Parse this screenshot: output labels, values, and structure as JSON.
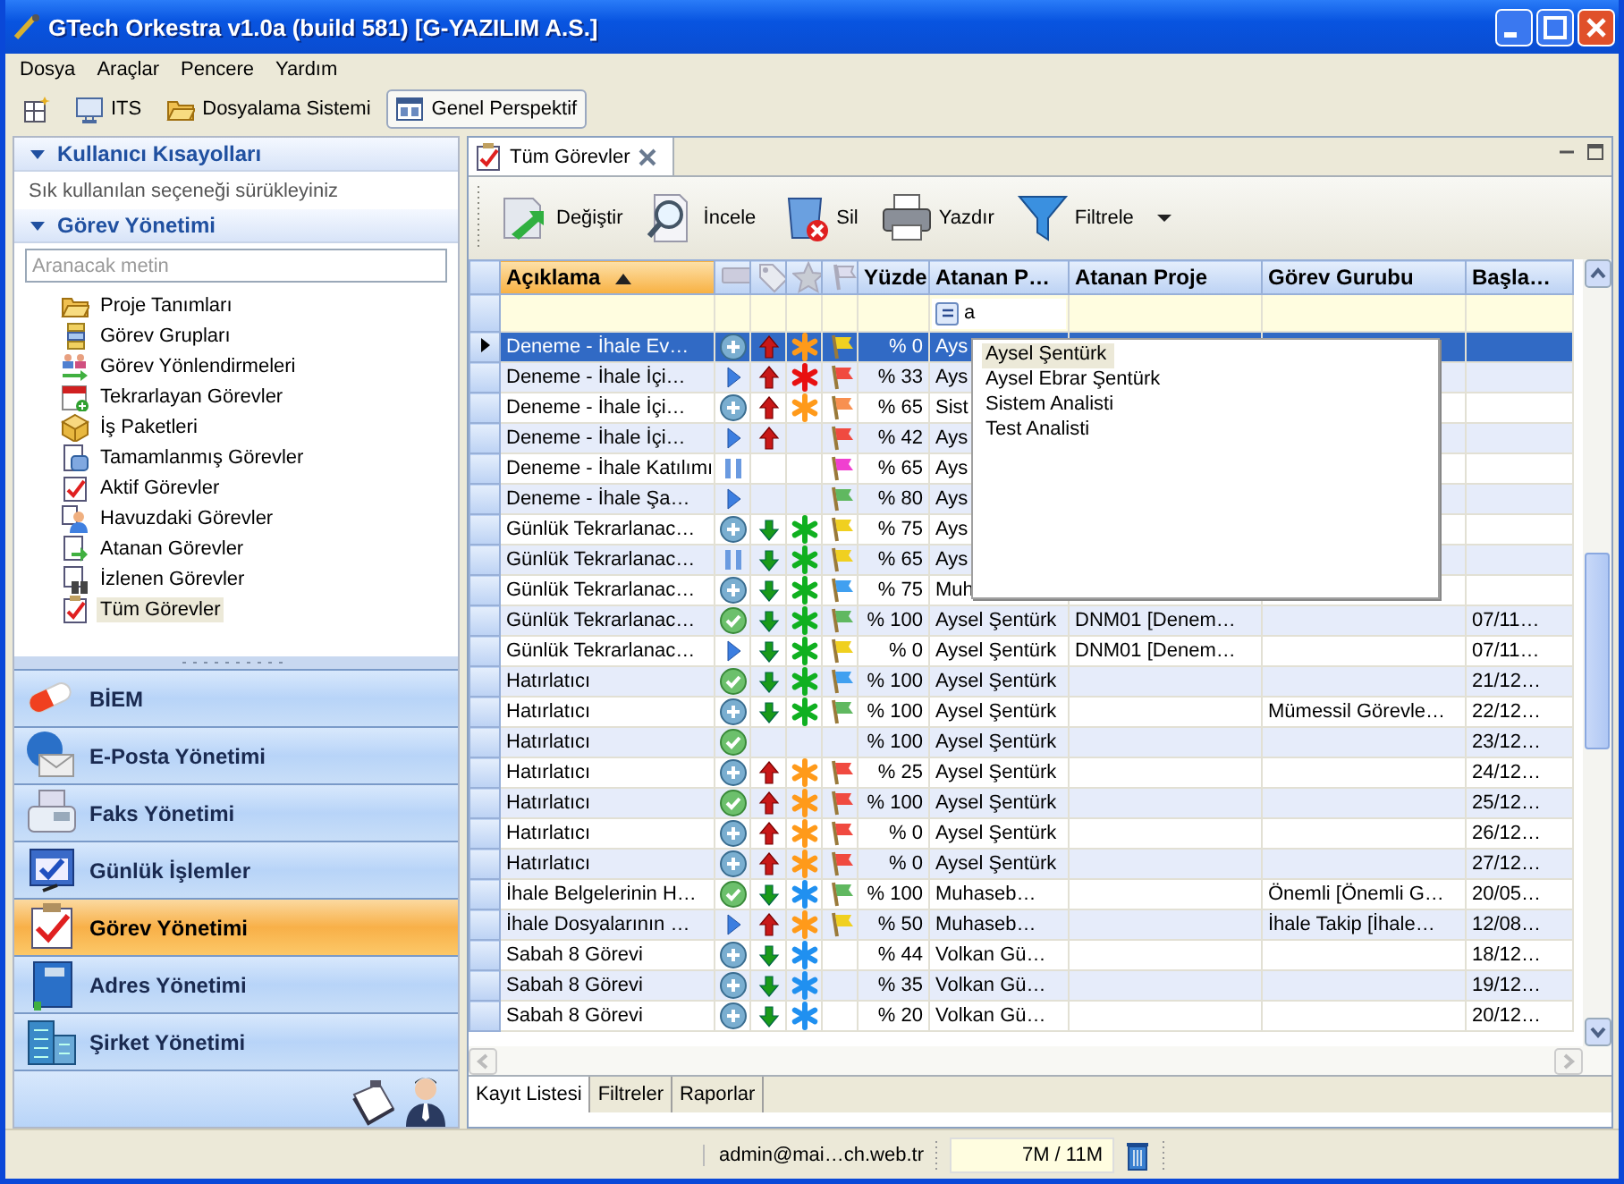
{
  "window": {
    "title": "GTech Orkestra v1.0a (build 581) [G-YAZILIM A.S.]"
  },
  "menu": [
    "Dosya",
    "Araçlar",
    "Pencere",
    "Yardım"
  ],
  "toolbar": [
    {
      "kind": "icon",
      "selected": false
    },
    {
      "kind": "button",
      "label": "ITS",
      "selected": false
    },
    {
      "kind": "button",
      "label": "Dosyalama Sistemi",
      "selected": false
    },
    {
      "kind": "button",
      "label": "Genel Perspektif",
      "selected": true
    }
  ],
  "sidebar": {
    "shortcuts": {
      "title": "Kullanıcı Kısayolları",
      "expanded": true,
      "hint": "Sık kullanılan seçeneği sürükleyiniz"
    },
    "tasks": {
      "title": "Görev Yönetimi",
      "expanded": true,
      "search_placeholder": "Aranacak metin",
      "items": [
        {
          "label": "Proje Tanımları",
          "selected": false
        },
        {
          "label": "Görev Grupları",
          "selected": false
        },
        {
          "label": "Görev Yönlendirmeleri",
          "selected": false
        },
        {
          "label": "Tekrarlayan Görevler",
          "selected": false
        },
        {
          "label": "İş Paketleri",
          "selected": false
        },
        {
          "label": "Tamamlanmış Görevler",
          "selected": false
        },
        {
          "label": "Aktif Görevler",
          "selected": false
        },
        {
          "label": "Havuzdaki Görevler",
          "selected": false
        },
        {
          "label": "Atanan Görevler",
          "selected": false
        },
        {
          "label": "İzlenen Görevler",
          "selected": false
        },
        {
          "label": "Tüm Görevler",
          "selected": true
        }
      ]
    },
    "nav": [
      {
        "label": "BİEM",
        "selected": false
      },
      {
        "label": "E-Posta Yönetimi",
        "selected": false
      },
      {
        "label": "Faks Yönetimi",
        "selected": false
      },
      {
        "label": "Günlük İşlemler",
        "selected": false
      },
      {
        "label": "Görev Yönetimi",
        "selected": true
      },
      {
        "label": "Adres Yönetimi",
        "selected": false
      },
      {
        "label": "Şirket Yönetimi",
        "selected": false
      }
    ]
  },
  "tab": {
    "title": "Tüm Görevler"
  },
  "actions": [
    {
      "label": "Değiştir",
      "dropdown": false
    },
    {
      "label": "İncele",
      "dropdown": false
    },
    {
      "label": "Sil",
      "dropdown": false
    },
    {
      "label": "Yazdır",
      "dropdown": false
    },
    {
      "label": "Filtrele",
      "dropdown": true
    }
  ],
  "table": {
    "columns": [
      {
        "kind": "text",
        "label": "Açıklama",
        "sorted": true
      },
      {
        "kind": "status",
        "sorted": false
      },
      {
        "kind": "priority",
        "sorted": false
      },
      {
        "kind": "importance",
        "sorted": false
      },
      {
        "kind": "flag",
        "sorted": false
      },
      {
        "kind": "text",
        "label": "Yüzde",
        "sorted": false
      },
      {
        "kind": "text",
        "label": "Atanan P…",
        "sorted": false
      },
      {
        "kind": "text",
        "label": "Atanan Proje",
        "sorted": false
      },
      {
        "kind": "text",
        "label": "Görev Gurubu",
        "sorted": false
      },
      {
        "kind": "text",
        "label": "Başla…",
        "sorted": false
      }
    ],
    "filter": {
      "value": "a"
    },
    "rows": [
      {
        "selected": true,
        "cells": [
          "Deneme - İhale Ev…",
          {
            "kind": "plus"
          },
          {
            "kind": "up"
          },
          {
            "kind": "asterisk",
            "color": "#ff9a1a"
          },
          {
            "kind": "flag",
            "color": "#f0d020"
          },
          "% 0",
          "Ays"
        ]
      },
      {
        "selected": false,
        "cells": [
          "Deneme - İhale İçi…",
          {
            "kind": "play"
          },
          {
            "kind": "up"
          },
          {
            "kind": "asterisk",
            "color": "#e81010"
          },
          {
            "kind": "flag",
            "color": "#f04a40"
          },
          "% 33",
          "Ays"
        ]
      },
      {
        "selected": false,
        "cells": [
          "Deneme - İhale İçi…",
          {
            "kind": "plus"
          },
          {
            "kind": "up"
          },
          {
            "kind": "asterisk",
            "color": "#ff9a1a"
          },
          {
            "kind": "flag",
            "color": "#f89050"
          },
          "% 65",
          "Sist"
        ]
      },
      {
        "selected": false,
        "cells": [
          "Deneme - İhale İçi…",
          {
            "kind": "play"
          },
          {
            "kind": "up"
          },
          "",
          {
            "kind": "flag",
            "color": "#f04a40"
          },
          "% 42",
          "Ays"
        ]
      },
      {
        "selected": false,
        "cells": [
          "Deneme - İhale Katılımı",
          {
            "kind": "pause"
          },
          "",
          "",
          {
            "kind": "flag",
            "color": "#f040d0"
          },
          "% 65",
          "Ays"
        ]
      },
      {
        "selected": false,
        "cells": [
          "Deneme - İhale Şa…",
          {
            "kind": "play"
          },
          "",
          "",
          {
            "kind": "flag",
            "color": "#60b860"
          },
          "% 80",
          "Ays"
        ]
      },
      {
        "selected": false,
        "cells": [
          "Günlük Tekrarlanac…",
          {
            "kind": "plus"
          },
          {
            "kind": "down"
          },
          {
            "kind": "asterisk",
            "color": "#10b020"
          },
          {
            "kind": "flag",
            "color": "#f0d020"
          },
          "% 75",
          "Ays"
        ]
      },
      {
        "selected": false,
        "cells": [
          "Günlük Tekrarlanac…",
          {
            "kind": "pause"
          },
          {
            "kind": "down"
          },
          {
            "kind": "asterisk",
            "color": "#10b020"
          },
          {
            "kind": "flag",
            "color": "#f0d020"
          },
          "% 65",
          "Ays"
        ]
      },
      {
        "selected": false,
        "cells": [
          "Günlük Tekrarlanac…",
          {
            "kind": "plus"
          },
          {
            "kind": "down"
          },
          {
            "kind": "asterisk",
            "color": "#10b020"
          },
          {
            "kind": "flag",
            "color": "#40a0f0"
          },
          "% 75",
          "Muh"
        ]
      },
      {
        "selected": false,
        "cells": [
          "Günlük Tekrarlanac…",
          {
            "kind": "check"
          },
          {
            "kind": "down"
          },
          {
            "kind": "asterisk",
            "color": "#10b020"
          },
          {
            "kind": "flag",
            "color": "#60b860"
          },
          "% 100",
          "Aysel Şentürk",
          "DNM01 [Denem…",
          "",
          "07/11…"
        ]
      },
      {
        "selected": false,
        "cells": [
          "Günlük Tekrarlanac…",
          {
            "kind": "play"
          },
          {
            "kind": "down"
          },
          {
            "kind": "asterisk",
            "color": "#10b020"
          },
          {
            "kind": "flag",
            "color": "#f0d020"
          },
          "% 0",
          "Aysel Şentürk",
          "DNM01 [Denem…",
          "",
          "07/11…"
        ]
      },
      {
        "selected": false,
        "cells": [
          "Hatırlatıcı",
          {
            "kind": "check"
          },
          {
            "kind": "down"
          },
          {
            "kind": "asterisk",
            "color": "#10b020"
          },
          {
            "kind": "flag",
            "color": "#40a0f0"
          },
          "% 100",
          "Aysel Şentürk",
          "",
          "",
          "21/12…"
        ]
      },
      {
        "selected": false,
        "cells": [
          "Hatırlatıcı",
          {
            "kind": "plus"
          },
          {
            "kind": "down"
          },
          {
            "kind": "asterisk",
            "color": "#10b020"
          },
          {
            "kind": "flag",
            "color": "#60b860"
          },
          "% 100",
          "Aysel Şentürk",
          "",
          "Mümessil Görevle…",
          "22/12…"
        ]
      },
      {
        "selected": false,
        "cells": [
          "Hatırlatıcı",
          {
            "kind": "check"
          },
          "",
          "",
          "",
          "% 100",
          "Aysel Şentürk",
          "",
          "",
          "23/12…"
        ]
      },
      {
        "selected": false,
        "cells": [
          "Hatırlatıcı",
          {
            "kind": "plus"
          },
          {
            "kind": "up"
          },
          {
            "kind": "asterisk",
            "color": "#ff9a1a"
          },
          {
            "kind": "flag",
            "color": "#f04a40"
          },
          "% 25",
          "Aysel Şentürk",
          "",
          "",
          "24/12…"
        ]
      },
      {
        "selected": false,
        "cells": [
          "Hatırlatıcı",
          {
            "kind": "check"
          },
          {
            "kind": "up"
          },
          {
            "kind": "asterisk",
            "color": "#ff9a1a"
          },
          {
            "kind": "flag",
            "color": "#f04a40"
          },
          "% 100",
          "Aysel Şentürk",
          "",
          "",
          "25/12…"
        ]
      },
      {
        "selected": false,
        "cells": [
          "Hatırlatıcı",
          {
            "kind": "plus"
          },
          {
            "kind": "up"
          },
          {
            "kind": "asterisk",
            "color": "#ff9a1a"
          },
          {
            "kind": "flag",
            "color": "#f04a40"
          },
          "% 0",
          "Aysel Şentürk",
          "",
          "",
          "26/12…"
        ]
      },
      {
        "selected": false,
        "cells": [
          "Hatırlatıcı",
          {
            "kind": "plus"
          },
          {
            "kind": "up"
          },
          {
            "kind": "asterisk",
            "color": "#ff9a1a"
          },
          {
            "kind": "flag",
            "color": "#f04a40"
          },
          "% 0",
          "Aysel Şentürk",
          "",
          "",
          "27/12…"
        ]
      },
      {
        "selected": false,
        "cells": [
          "İhale Belgelerinin H…",
          {
            "kind": "check"
          },
          {
            "kind": "down"
          },
          {
            "kind": "asterisk",
            "color": "#2090f0"
          },
          {
            "kind": "flag",
            "color": "#60b860"
          },
          "% 100",
          "Muhaseb…",
          "",
          "Önemli [Önemli G…",
          "20/05…"
        ]
      },
      {
        "selected": false,
        "cells": [
          "İhale Dosyalarının …",
          {
            "kind": "play"
          },
          {
            "kind": "up"
          },
          {
            "kind": "asterisk",
            "color": "#ff9a1a"
          },
          {
            "kind": "flag",
            "color": "#f0d020"
          },
          "% 50",
          "Muhaseb…",
          "",
          "İhale Takip [İhale…",
          "12/08…"
        ]
      },
      {
        "selected": false,
        "cells": [
          "Sabah 8 Görevi",
          {
            "kind": "plus"
          },
          {
            "kind": "down"
          },
          {
            "kind": "asterisk",
            "color": "#2090f0"
          },
          "",
          "% 44",
          "Volkan Gü…",
          "",
          "",
          "18/12…"
        ]
      },
      {
        "selected": false,
        "cells": [
          "Sabah 8 Görevi",
          {
            "kind": "plus"
          },
          {
            "kind": "down"
          },
          {
            "kind": "asterisk",
            "color": "#2090f0"
          },
          "",
          "% 35",
          "Volkan Gü…",
          "",
          "",
          "19/12…"
        ]
      },
      {
        "selected": false,
        "cells": [
          "Sabah 8 Görevi",
          {
            "kind": "plus"
          },
          {
            "kind": "down"
          },
          {
            "kind": "asterisk",
            "color": "#2090f0"
          },
          "",
          "% 20",
          "Volkan Gü…",
          "",
          "",
          "20/12…"
        ]
      }
    ]
  },
  "popup": {
    "items": [
      {
        "label": "Aysel Şentürk",
        "selected": true
      },
      {
        "label": "Aysel Ebrar Şentürk",
        "selected": false
      },
      {
        "label": "Sistem Analisti",
        "selected": false
      },
      {
        "label": "Test Analisti",
        "selected": false
      }
    ]
  },
  "bottom_tabs": [
    {
      "label": "Kayıt Listesi",
      "selected": true
    },
    {
      "label": "Filtreler",
      "selected": false
    },
    {
      "label": "Raporlar",
      "selected": false
    }
  ],
  "status_bar": {
    "user": "admin@mai…ch.web.tr",
    "memory": "7M / 11M"
  }
}
